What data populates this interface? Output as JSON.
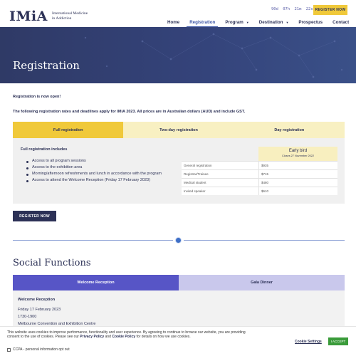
{
  "header": {
    "logo": "IMiA",
    "logo_sub_line1": "International Medicine",
    "logo_sub_line2": "in Addiction",
    "countdown": [
      "90d",
      "07h",
      "21m",
      "22s"
    ],
    "register_label": "REGISTER NOW"
  },
  "nav": [
    {
      "label": "Home",
      "dropdown": false,
      "active": false
    },
    {
      "label": "Registration",
      "dropdown": false,
      "active": true
    },
    {
      "label": "Program",
      "dropdown": true,
      "active": false
    },
    {
      "label": "Destination",
      "dropdown": true,
      "active": false
    },
    {
      "label": "Prospectus",
      "dropdown": false,
      "active": false
    },
    {
      "label": "Contact",
      "dropdown": false,
      "active": false
    }
  ],
  "hero": {
    "title": "Registration"
  },
  "intro": {
    "open": "Registration is now open!",
    "rates": "The following registration rates and deadlines apply for IMiA 2023. All prices are in Australian dollars (AUD) and include GST."
  },
  "registration_tabs": [
    "Full registration",
    "Two-day registration",
    "Day registration"
  ],
  "full_registration": {
    "heading": "Full registration includes",
    "items": [
      "Access to all program sessions",
      "Access to the exhibition area",
      "Morning/afternoon refreshments and lunch in accordance with the program",
      "Access to attend the Welcome Reception (Friday 17 February 2023)"
    ],
    "rate_header": {
      "title": "Early bird",
      "closes": "Closes 27 November 2022"
    },
    "rates": [
      {
        "label": "General registration",
        "price": "$935"
      },
      {
        "label": "Registrar/Trainee",
        "price": "$715"
      },
      {
        "label": "Medical student",
        "price": "$480"
      },
      {
        "label": "Invited speaker",
        "price": "$610"
      }
    ],
    "button": "REGISTER NOW"
  },
  "social": {
    "title": "Social Functions",
    "tabs": [
      "Welcome Reception",
      "Gala Dinner"
    ],
    "panel_heading": "Welcome Reception",
    "date": "Friday 17 February 2023",
    "time": "1730-1900",
    "venue": "Melbourne Convention and Exhibition Centre"
  },
  "cookie": {
    "text_part1": "This website uses cookies to improve performance, functionality and user experience. By agreeing to continue to browse our website, you are providing consent to the use of cookies. Please see our ",
    "privacy_link": "Privacy Policy",
    "and": " and ",
    "cookie_link": "Cookie Policy",
    "text_part2": " for details on how we use cookies.",
    "settings": "Cookie Settings",
    "accept": "I ACCEPT",
    "ccpa": "CCPA - personal information opt out"
  },
  "colors": {
    "navy": "#2c3156",
    "gold": "#f0c93a",
    "light_gold": "#f8f0c2",
    "purple": "#5755c6",
    "light_purple": "#c9c8ec",
    "accept_green": "#3a9b3a"
  }
}
